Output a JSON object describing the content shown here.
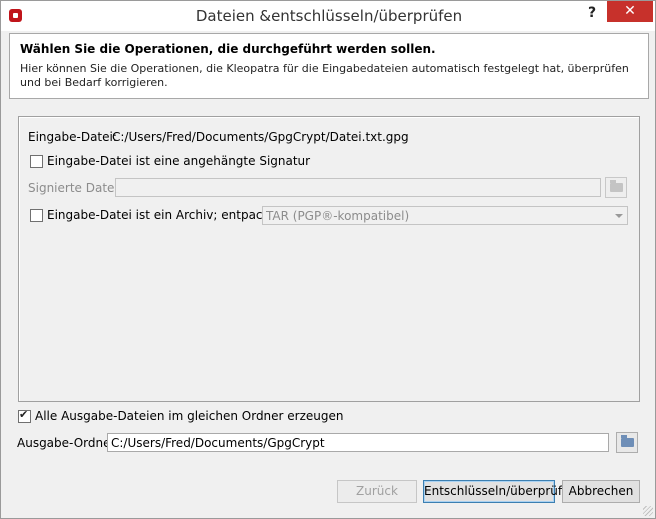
{
  "window": {
    "title": "Dateien &entschlüsseln/überprüfen",
    "help_label": "?",
    "close_label": "✕"
  },
  "header": {
    "title": "Wählen Sie die Operationen, die durchgeführt werden sollen.",
    "description": "Hier können Sie die Operationen, die Kleopatra für die Eingabedateien automatisch festgelegt hat, überprüfen und bei Bedarf korrigieren."
  },
  "operations": {
    "input_file_label": "Eingabe-Datei:",
    "input_file_value": "C:/Users/Fred/Documents/GpgCrypt/Datei.txt.gpg",
    "detached_signature": {
      "label": "Eingabe-Datei ist eine angehängte Signatur",
      "checked": false
    },
    "signed_data_label": "Signierte Daten:",
    "signed_data_value": "",
    "archive": {
      "label": "Eingabe-Datei ist ein Archiv; entpacke mit:",
      "checked": false
    },
    "archive_format": "TAR (PGP®-kompatibel)"
  },
  "output": {
    "same_folder": {
      "label": "Alle Ausgabe-Dateien im gleichen Ordner erzeugen",
      "checked": true
    },
    "folder_label": "Ausgabe-Ordner:",
    "folder_value": "C:/Users/Fred/Documents/GpgCrypt"
  },
  "buttons": {
    "back": "Zurück",
    "decrypt": "Entschlüsseln/überprüfen",
    "cancel": "Abbrechen"
  },
  "icons": [
    "app-icon",
    "help-icon",
    "close-icon",
    "folder-icon"
  ],
  "colors": {
    "close_button": "#c7312b",
    "app_icon": "#c0141a",
    "primary_button_border": "#3c7fb1"
  }
}
